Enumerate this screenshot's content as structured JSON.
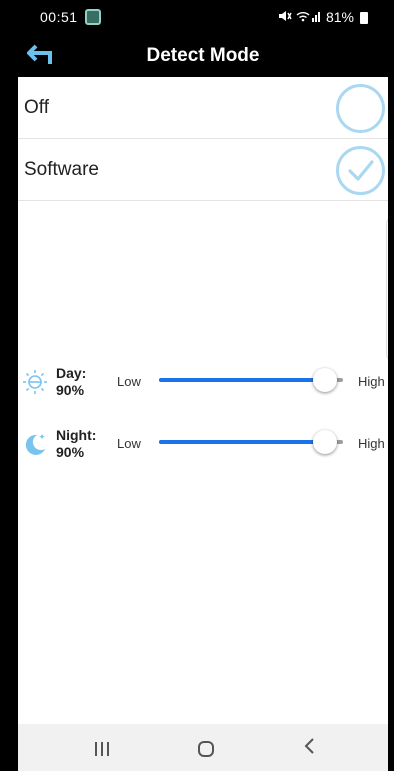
{
  "status_bar": {
    "time": "00:51",
    "battery": "81%",
    "mute_icon": "mute-icon",
    "signal_icon": "wifi-signal-icon"
  },
  "header": {
    "title": "Detect Mode",
    "back_icon": "back-arrow-icon",
    "accent": "#6cc0ee"
  },
  "options": [
    {
      "label": "Off",
      "selected": false
    },
    {
      "label": "Software",
      "selected": true
    }
  ],
  "sliders": {
    "day": {
      "title": "Day:",
      "value": "90%",
      "level": 0.9,
      "low": "Low",
      "high": "High",
      "icon": "sun-icon"
    },
    "night": {
      "title": "Night:",
      "value": "90%",
      "level": 0.9,
      "low": "Low",
      "high": "High",
      "icon": "moon-icon"
    }
  },
  "colors": {
    "slider_active": "#1a73e8",
    "radio_ring": "#a9d8f0",
    "icon_blue": "#79c4ee"
  }
}
